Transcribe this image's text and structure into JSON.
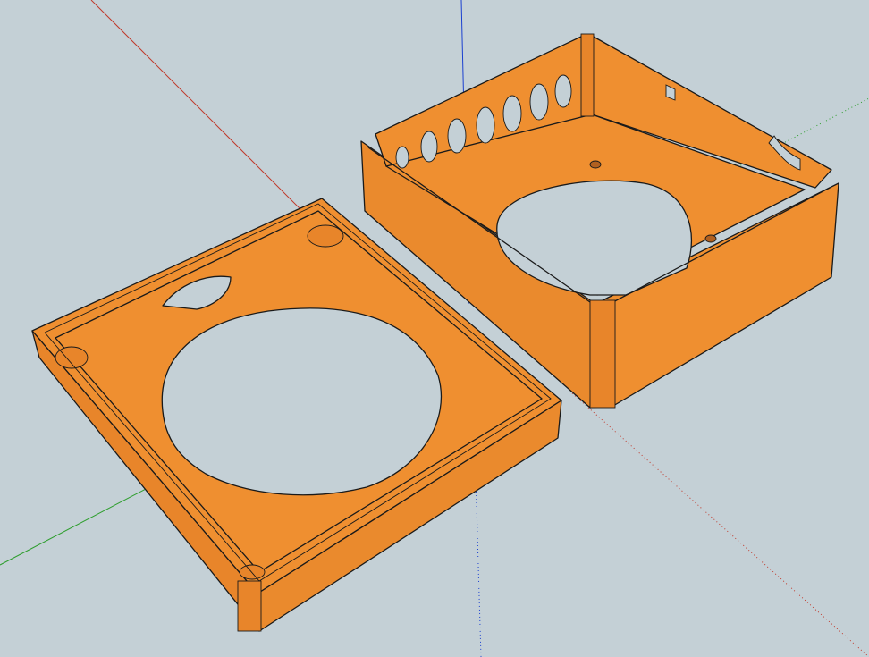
{
  "scene": {
    "background_color": "#c4d0d6",
    "model_color": "#ef8f30",
    "model_shade_color": "#e8852a",
    "edge_color": "#1a1a1a",
    "axis_colors": {
      "red": "#c0392b",
      "green": "#2e9e2e",
      "blue": "#1a3fd0"
    },
    "objects": [
      "enclosure-lid",
      "enclosure-base"
    ],
    "base_vent_hole_count": 7
  }
}
